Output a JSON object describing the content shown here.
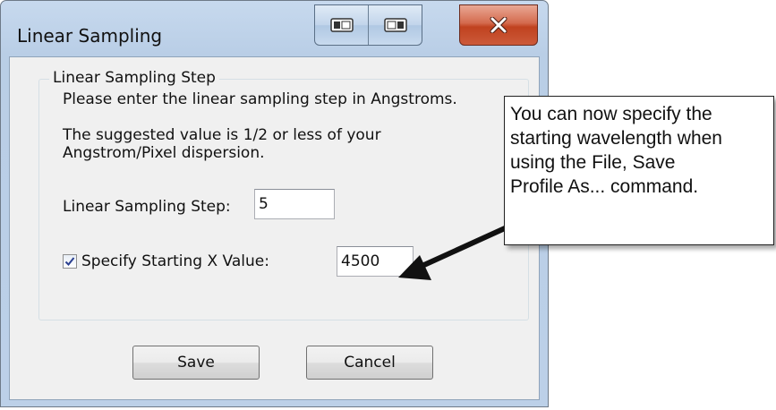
{
  "window": {
    "title": "Linear Sampling",
    "caption_buttons": [
      {
        "icon": "restore-left-icon"
      },
      {
        "icon": "restore-right-icon"
      }
    ],
    "close_icon": "close-icon"
  },
  "group": {
    "title": "Linear Sampling Step",
    "instruction": "Please enter the linear sampling step in Angstroms.",
    "suggestion_line1": "The suggested value is 1/2 or less of your",
    "suggestion_line2": "Angstrom/Pixel dispersion.",
    "step_label": "Linear Sampling Step:",
    "step_value": "5",
    "specify_checkbox_checked": true,
    "specify_label": "Specify Starting X Value:",
    "start_value": "4500"
  },
  "buttons": {
    "save_label": "Save",
    "cancel_label": "Cancel"
  },
  "callout": {
    "lines": [
      "You can now specify the",
      "starting wavelength when",
      "using the File, Save",
      "Profile As... command."
    ]
  }
}
